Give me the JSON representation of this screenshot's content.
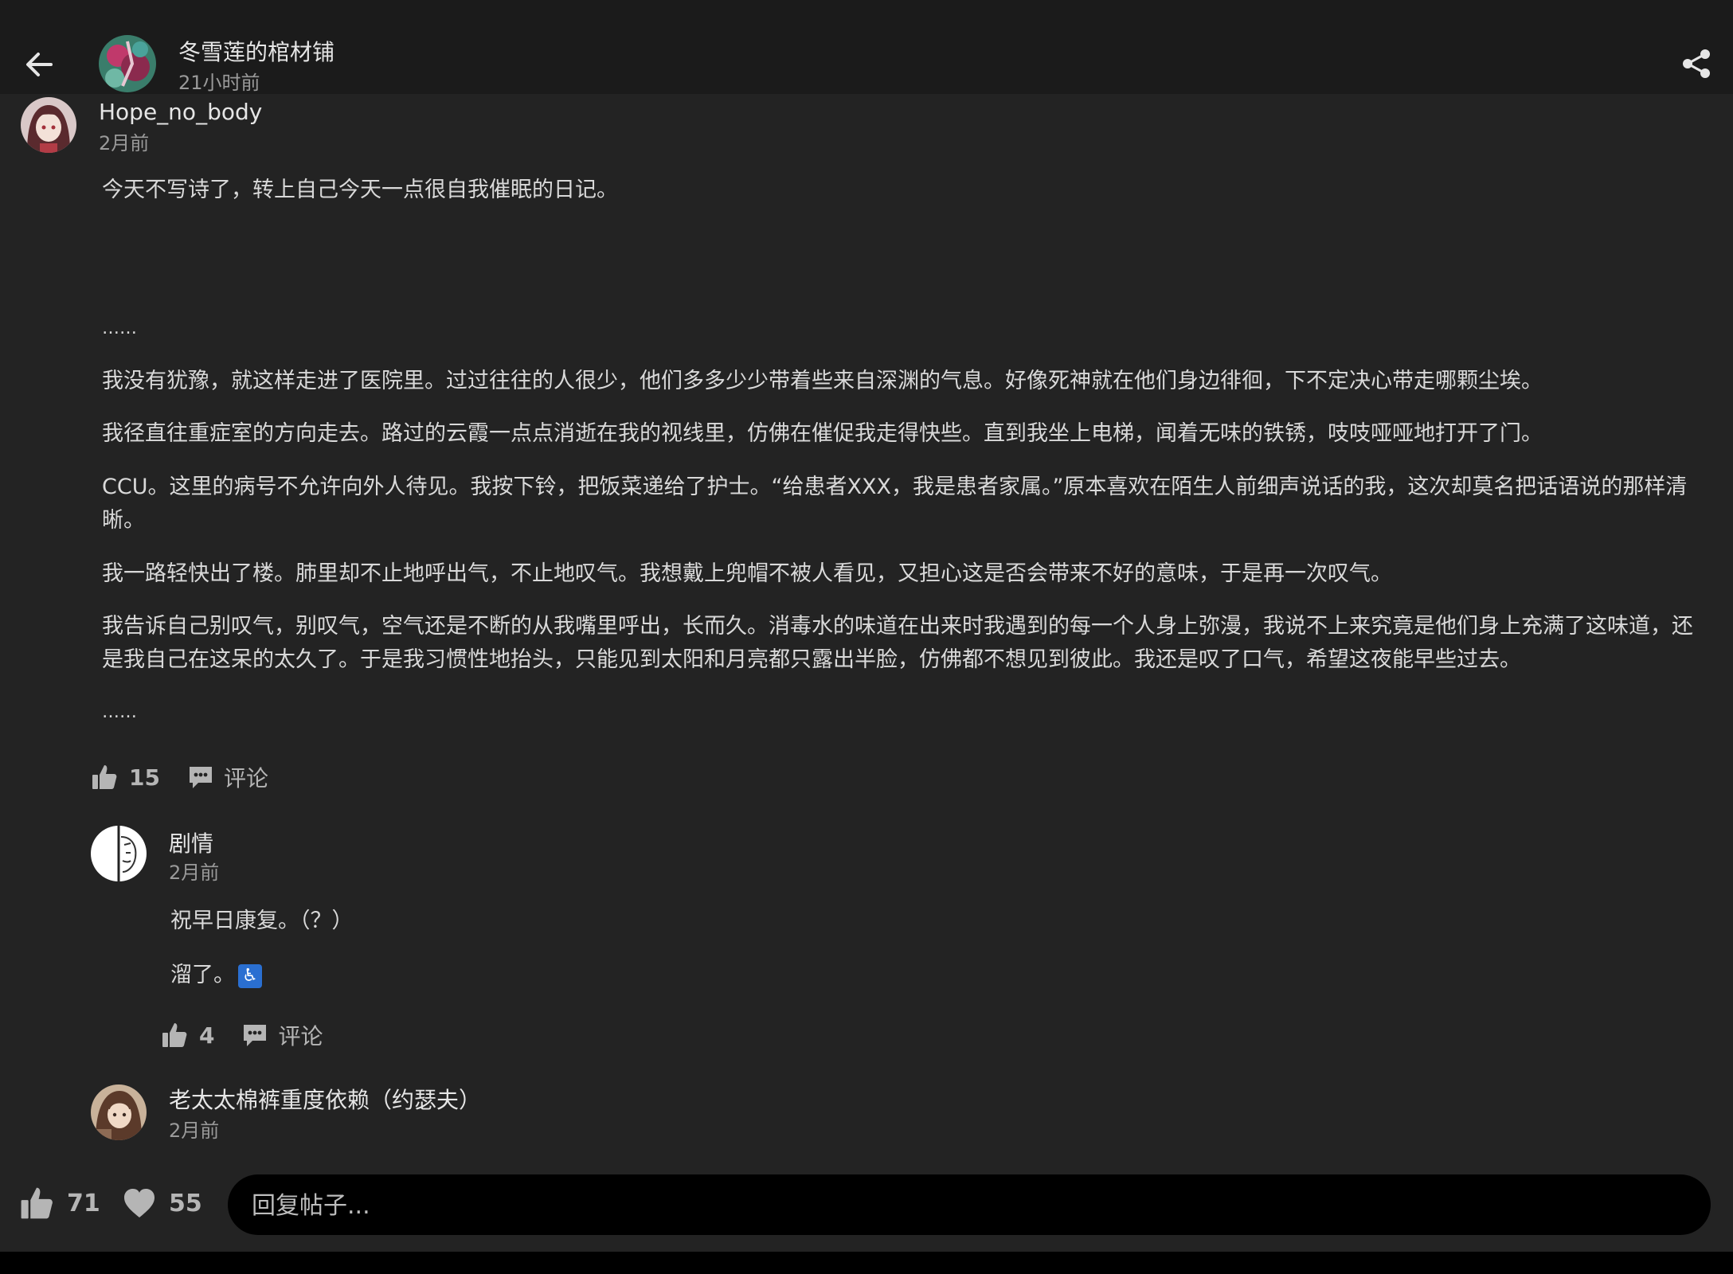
{
  "header": {
    "title": "冬雪莲的棺材铺",
    "time": "21小时前"
  },
  "post": {
    "author": "Hope_no_body",
    "time": "2月前",
    "intro": "今天不写诗了，转上自己今天一点很自我催眠的日记。",
    "ellipsis": "……",
    "paragraphs": [
      "我没有犹豫，就这样走进了医院里。过过往往的人很少，他们多多少少带着些来自深渊的气息。好像死神就在他们身边徘徊，下不定决心带走哪颗尘埃。",
      "我径直往重症室的方向走去。路过的云霞一点点消逝在我的视线里，仿佛在催促我走得快些。直到我坐上电梯，闻着无味的铁锈，吱吱哑哑地打开了门。",
      "CCU。这里的病号不允许向外人待见。我按下铃，把饭菜递给了护士。“给患者XXX，我是患者家属。”原本喜欢在陌生人前细声说话的我，这次却莫名把话语说的那样清晰。",
      "我一路轻快出了楼。肺里却不止地呼出气，不止地叹气。我想戴上兜帽不被人看见，又担心这是否会带来不好的意味，于是再一次叹气。",
      "我告诉自己别叹气，别叹气，空气还是不断的从我嘴里呼出，长而久。消毒水的味道在出来时我遇到的每一个人身上弥漫，我说不上来究竟是他们身上充满了这味道，还是我自己在这呆的太久了。于是我习惯性地抬头，只能见到太阳和月亮都只露出半脸，仿佛都不想见到彼此。我还是叹了口气，希望这夜能早些过去。"
    ],
    "likes": "15",
    "comment_label": "评论"
  },
  "comments": [
    {
      "author": "剧情",
      "time": "2月前",
      "lines": [
        "祝早日康复。（？）",
        "溜了。"
      ],
      "emoji": "♿",
      "likes": "4",
      "comment_label": "评论"
    },
    {
      "author": "老太太棉裤重度依赖（约瑟夫）",
      "time": "2月前"
    }
  ],
  "footer": {
    "likes": "71",
    "favorites": "55",
    "reply_placeholder": "回复帖子..."
  },
  "colors": {
    "background": "#232323",
    "topbar": "#1b1b1b",
    "reply_box": "#000000",
    "wheelchair_emoji": "#2a6fd1"
  }
}
